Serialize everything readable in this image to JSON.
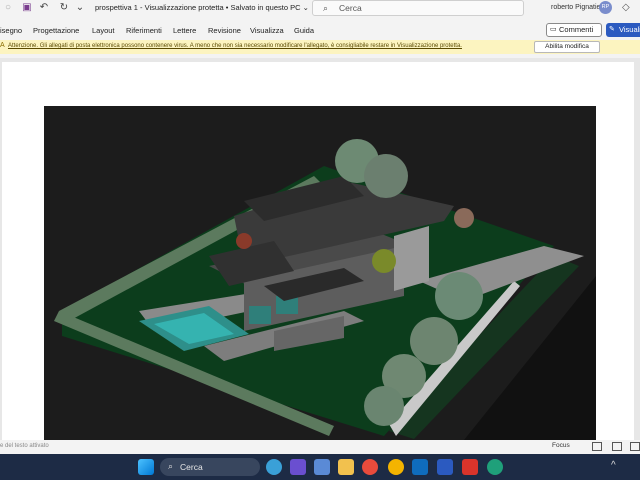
{
  "titlebar": {
    "document_title": "prospettiva 1  -  Visualizzazione protetta • Salvato in questo PC ⌄",
    "user_name": "roberto Pignatiello",
    "avatar_initials": "RP"
  },
  "search": {
    "placeholder": "Cerca"
  },
  "ribbon": {
    "tabs": [
      {
        "label": "isegno"
      },
      {
        "label": "Progettazione"
      },
      {
        "label": "Layout"
      },
      {
        "label": "Riferimenti"
      },
      {
        "label": "Lettere"
      },
      {
        "label": "Revisione"
      },
      {
        "label": "Visualizza"
      },
      {
        "label": "Guida"
      }
    ],
    "comments_label": "Commenti",
    "view_label": "Visuali"
  },
  "warning": {
    "icon": "A",
    "message": "Attenzione. Gli allegati di posta elettronica possono contenere virus. A meno che non sia necessario modificare l'allegato, è consigliabile restare in Visualizzazione protetta.",
    "enable_label": "Abilita modifica"
  },
  "statusbar": {
    "text": "e del testo attivato",
    "focus_label": "Focus"
  },
  "taskbar": {
    "search_label": "Cerca",
    "apps": [
      "windows-start",
      "search",
      "copilot",
      "meet",
      "mail-app",
      "file-explorer",
      "chrome",
      "chrome-alt",
      "outlook",
      "word",
      "acrobat",
      "edge"
    ]
  },
  "colors": {
    "accent": "#2b5ac0",
    "warning_bg": "#fcf4c0",
    "taskbar_bg": "#1d2b45",
    "render_bg": "#1c1c1c",
    "grass": "#0c3d1c"
  }
}
